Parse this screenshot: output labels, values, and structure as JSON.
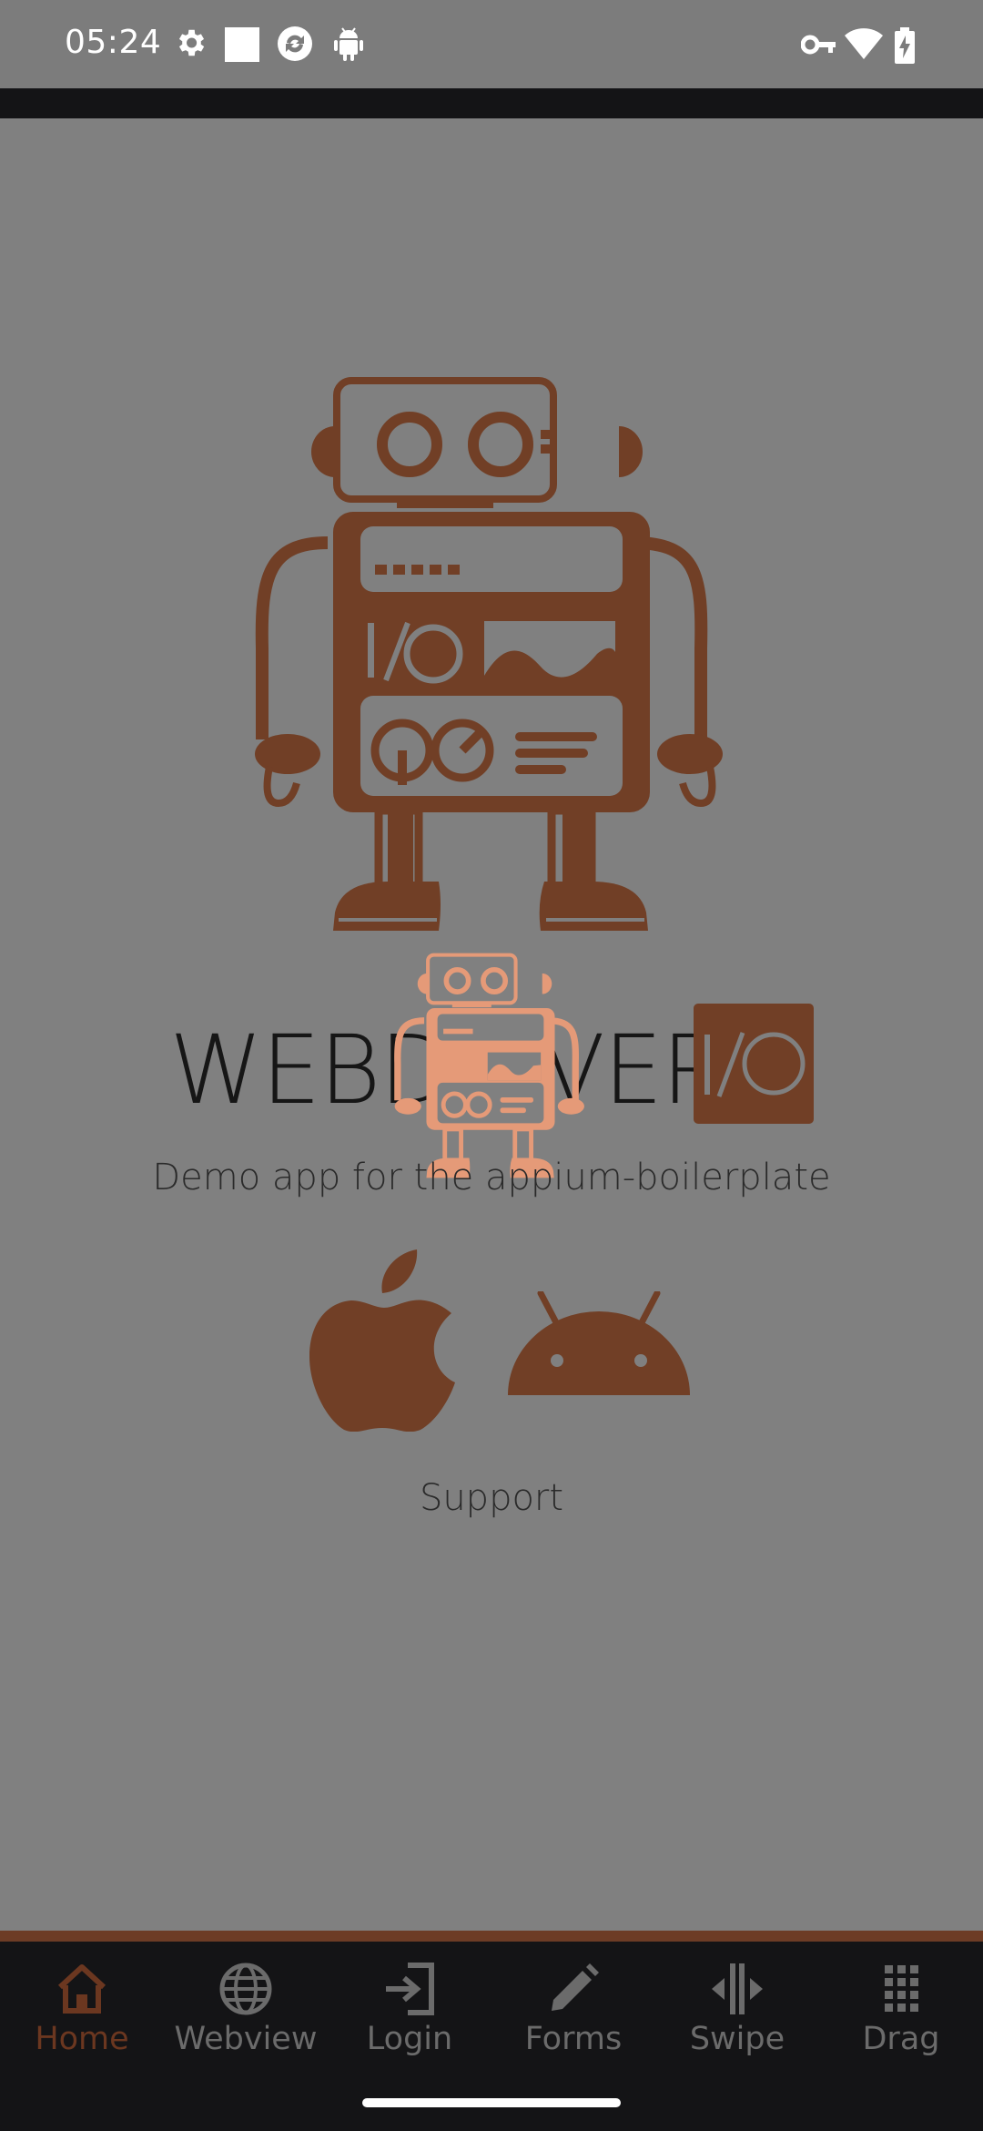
{
  "status_bar": {
    "time": "05:24",
    "left_icons": [
      "settings-gear-icon",
      "white-square-icon",
      "sync-icon",
      "android-debug-icon"
    ],
    "right_icons": [
      "vpn-key-icon",
      "wifi-icon",
      "battery-charging-icon"
    ]
  },
  "main": {
    "logo_text": "WEBDRIVER",
    "logo_badge_text": "I/O",
    "tagline": "Demo app for the appium-boilerplate",
    "support_label": "Support",
    "platform_icons": [
      "apple-icon",
      "android-icon"
    ]
  },
  "tabs": [
    {
      "label": "Home",
      "icon": "home-icon",
      "active": true
    },
    {
      "label": "Webview",
      "icon": "globe-icon",
      "active": false
    },
    {
      "label": "Login",
      "icon": "login-icon",
      "active": false
    },
    {
      "label": "Forms",
      "icon": "pencil-icon",
      "active": false
    },
    {
      "label": "Swipe",
      "icon": "swipe-icon",
      "active": false
    },
    {
      "label": "Drag",
      "icon": "grid-dots-icon",
      "active": false
    }
  ],
  "colors": {
    "brand": "#713f26",
    "overlay_bg": "#808080",
    "tab_bar_bg": "#141416",
    "tab_inactive": "#6b6b6b",
    "tab_active": "#6b3720"
  }
}
